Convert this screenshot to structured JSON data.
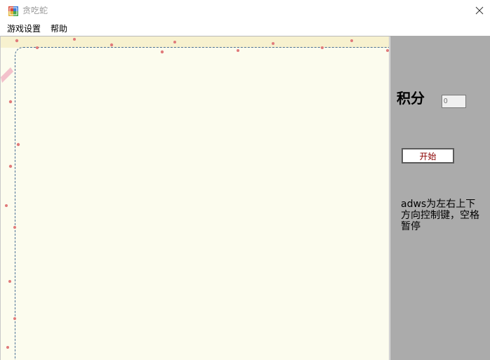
{
  "window": {
    "title": "贪吃蛇",
    "close_glyph": "✕"
  },
  "menu": {
    "game_settings": "游戏设置",
    "help": "帮助"
  },
  "side": {
    "score_label": "积分",
    "score_value": "0",
    "start_button": "开始",
    "instructions": "adws为左右上下方向控制键，空格暂停"
  },
  "colors": {
    "board_background": "#fcfcee",
    "side_background": "#ababab",
    "start_text": "#8b0000",
    "dot": "#e07a7a"
  }
}
